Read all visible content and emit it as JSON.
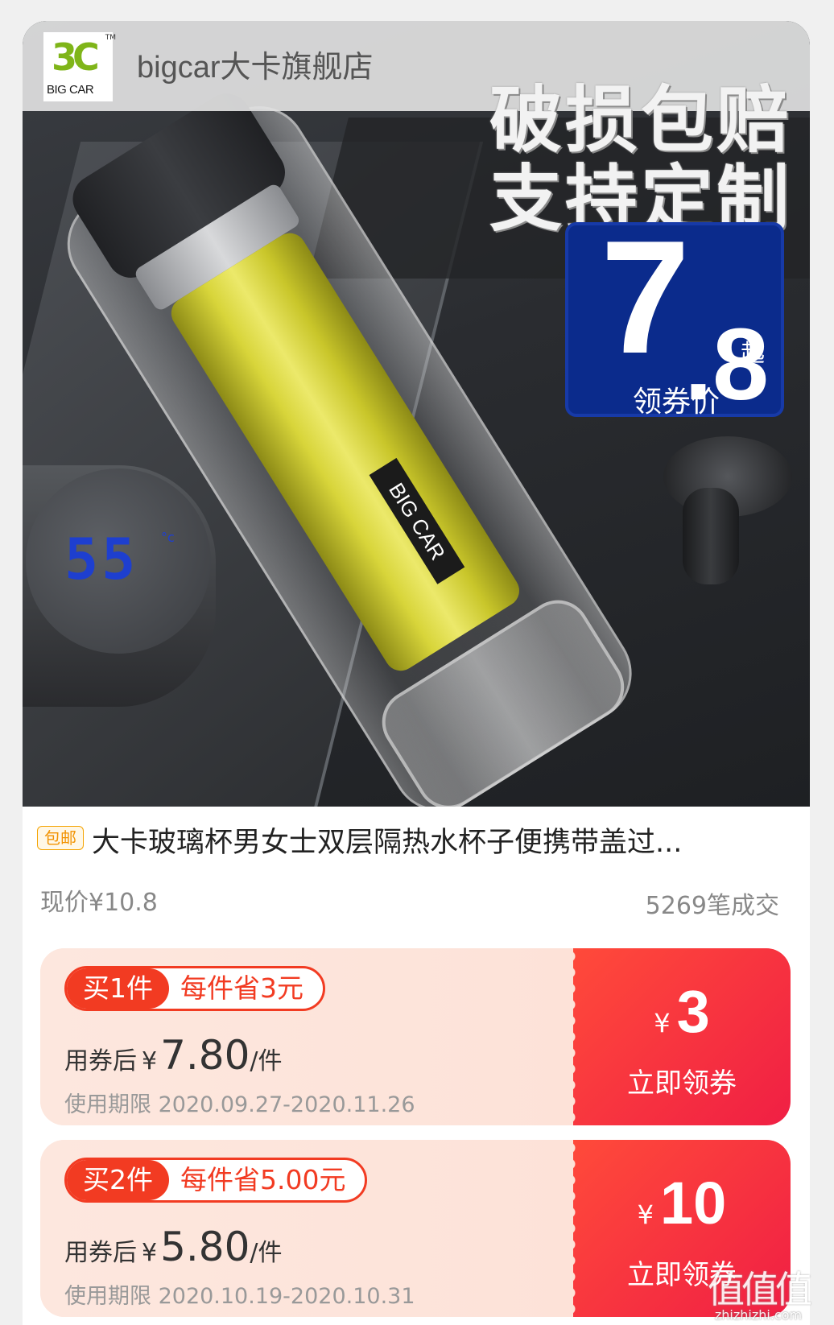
{
  "store": {
    "logo_mark": "3C",
    "logo_tm": "TM",
    "logo_text": "BIG CAR",
    "name": "bigcar大卡旗舰店"
  },
  "hero": {
    "promo_line_1": "破损包赔",
    "promo_line_2": "支持定制",
    "temperature": "55",
    "temperature_unit": "°c",
    "bottle_brand": "BIG CAR",
    "price_badge": {
      "integer": "7",
      "decimal": ".8",
      "suffix": "起",
      "caption": "领券价"
    }
  },
  "product": {
    "tag": "包邮",
    "title": "大卡玻璃杯男女士双层隔热水杯子便携带盖过...",
    "current_price": "现价¥10.8",
    "sold": "5269笔成交"
  },
  "coupons": [
    {
      "qty": "买1件",
      "save": "每件省3元",
      "after_label": "用券后",
      "currency": "¥",
      "after_price": "7.80",
      "unit": "/件",
      "validity": "使用期限 2020.09.27-2020.11.26",
      "face_currency": "¥",
      "face_value": "3",
      "claim": "立即领券"
    },
    {
      "qty": "买2件",
      "save": "每件省5.00元",
      "after_label": "用券后",
      "currency": "¥",
      "after_price": "5.80",
      "unit": "/件",
      "validity": "使用期限 2020.10.19-2020.10.31",
      "face_currency": "¥",
      "face_value": "10",
      "claim": "立即领券"
    }
  ],
  "watermark": {
    "glyph": "值值值",
    "url": "zhizhizhi.com"
  }
}
